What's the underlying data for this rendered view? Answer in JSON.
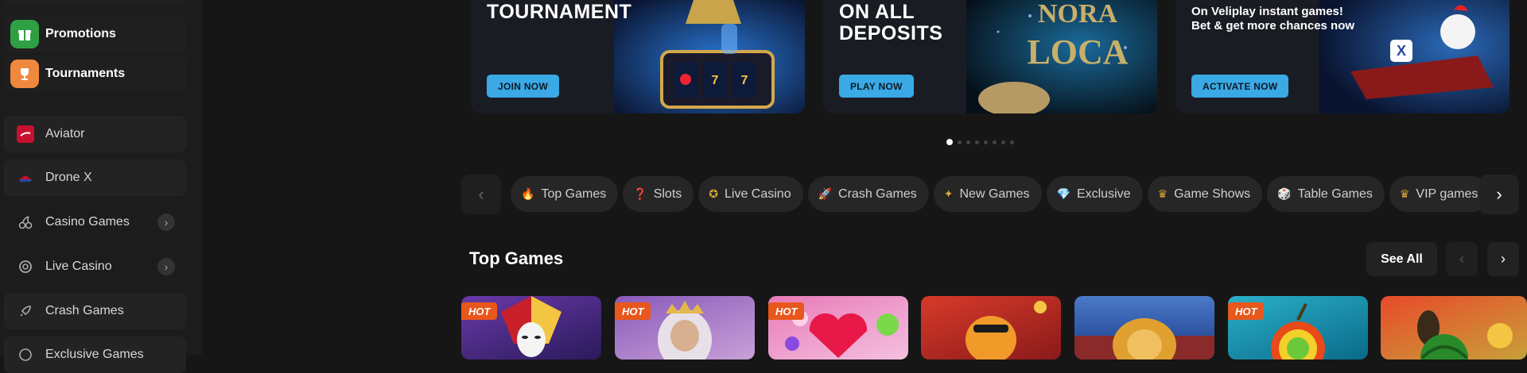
{
  "sidebar": {
    "top_items": [
      {
        "label": "Promotions",
        "icon": "gift-icon",
        "color": "#2ea043"
      },
      {
        "label": "Tournaments",
        "icon": "trophy-icon",
        "color": "#f0883e"
      }
    ],
    "items": [
      {
        "label": "Aviator",
        "icon": "aviator-icon",
        "has_chevron": false
      },
      {
        "label": "Drone X",
        "icon": "drone-icon",
        "has_chevron": false
      },
      {
        "label": "Casino Games",
        "icon": "cherries-icon",
        "has_chevron": true
      },
      {
        "label": "Live Casino",
        "icon": "chip-icon",
        "has_chevron": true
      },
      {
        "label": "Crash Games",
        "icon": "rocket-icon",
        "has_chevron": false
      },
      {
        "label": "Exclusive Games",
        "icon": "diamond-icon",
        "has_chevron": false
      }
    ]
  },
  "banners": [
    {
      "title": "TOURNAMENT",
      "cta": "JOIN NOW"
    },
    {
      "title_line1": "ON ALL",
      "title_line2": "DEPOSITS",
      "art_text_1": "NORA",
      "art_text_2": "LOCA",
      "cta": "PLAY NOW"
    },
    {
      "sub_line1": "On Veliplay instant games!",
      "sub_line2": "Bet & get more chances now",
      "cta": "ACTIVATE NOW"
    }
  ],
  "carousel": {
    "count": 8,
    "active": 0
  },
  "categories": [
    {
      "label": "Top Games",
      "icon": "flame-icon",
      "glyph": "🔥"
    },
    {
      "label": "Slots",
      "icon": "slots-icon",
      "glyph": "❓"
    },
    {
      "label": "Live Casino",
      "icon": "chip-icon",
      "glyph": "✪"
    },
    {
      "label": "Crash Games",
      "icon": "rocket-icon",
      "glyph": "🚀"
    },
    {
      "label": "New Games",
      "icon": "sparkle-icon",
      "glyph": "✦"
    },
    {
      "label": "Exclusive",
      "icon": "diamond-icon",
      "glyph": "💎"
    },
    {
      "label": "Game Shows",
      "icon": "gameshow-icon",
      "glyph": "♛"
    },
    {
      "label": "Table Games",
      "icon": "dice-icon",
      "glyph": "🎲"
    },
    {
      "label": "VIP games",
      "icon": "crown-icon",
      "glyph": "♛"
    }
  ],
  "top_games": {
    "title": "Top Games",
    "see_all": "See All",
    "hot_label": "HOT",
    "tiles": [
      {
        "name": "jester-game",
        "hot": true,
        "color": "#4a2a8a"
      },
      {
        "name": "zeus-game",
        "hot": true,
        "color": "#6a4a9a"
      },
      {
        "name": "candy-game",
        "hot": true,
        "color": "#d84a9a"
      },
      {
        "name": "tiger-game",
        "hot": false,
        "color": "#c83a2a"
      },
      {
        "name": "lion-game",
        "hot": false,
        "color": "#3a5a9a"
      },
      {
        "name": "fruit-game",
        "hot": true,
        "color": "#1a8a9a"
      },
      {
        "name": "watermelon-game",
        "hot": false,
        "color": "#c83a2a"
      }
    ]
  }
}
